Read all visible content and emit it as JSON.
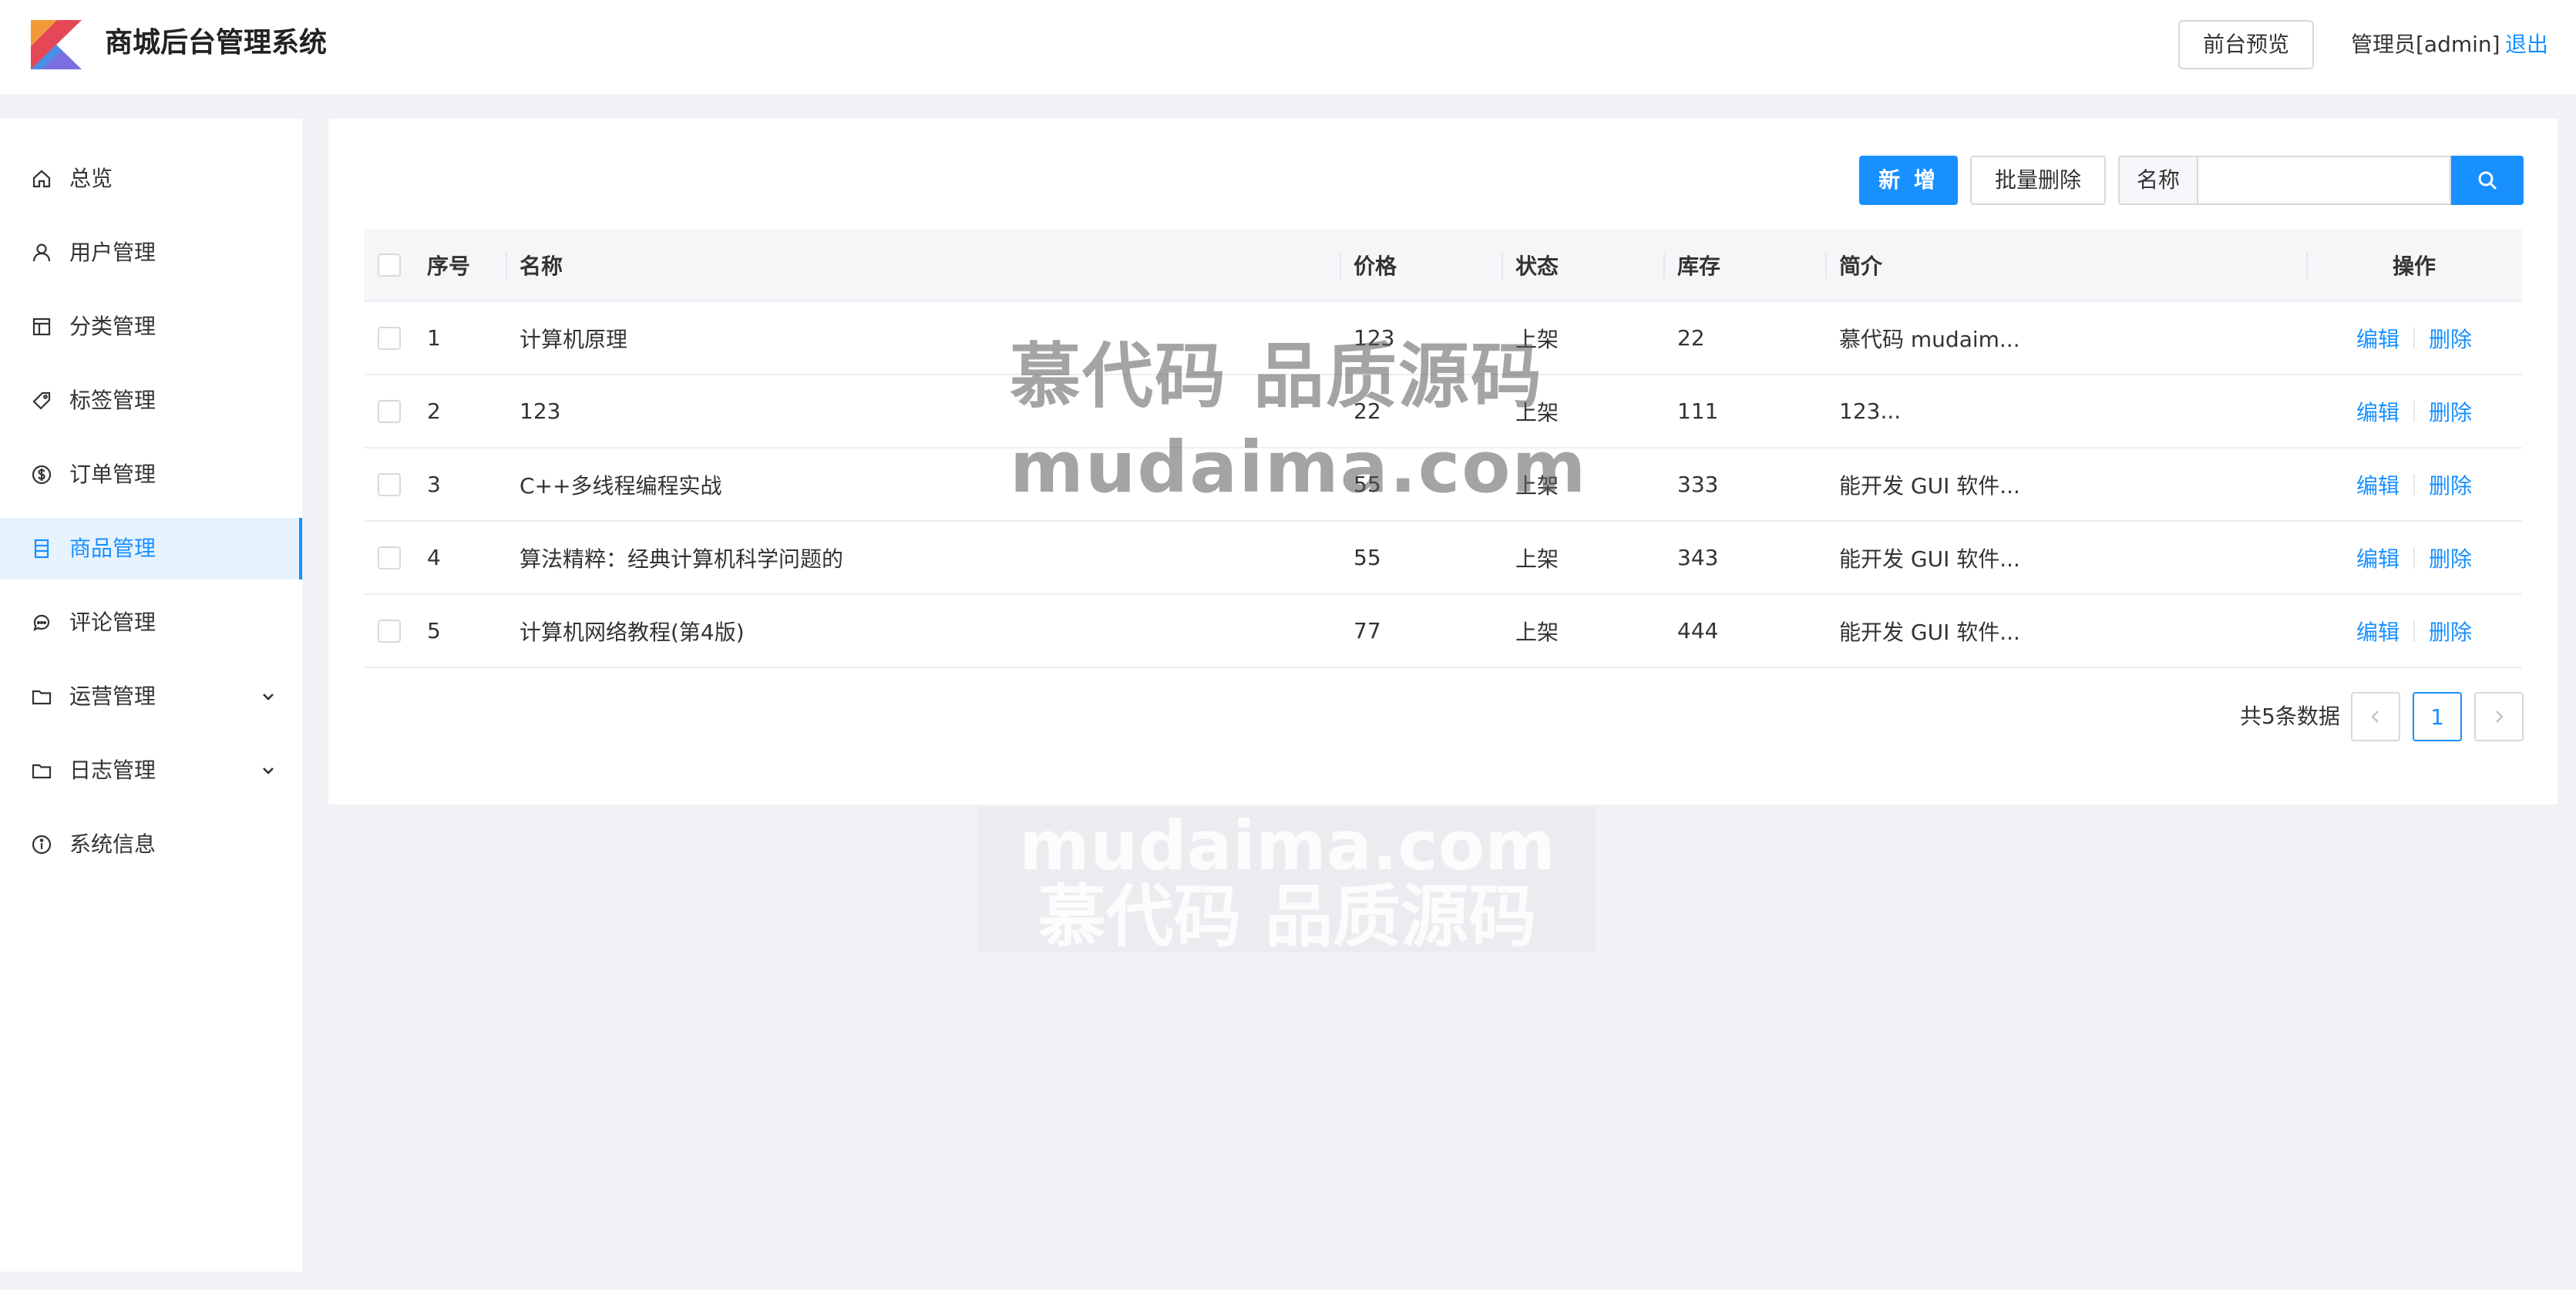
{
  "header": {
    "title": "商城后台管理系统",
    "preview_label": "前台预览",
    "admin_label": "管理员[admin]",
    "logout_label": "退出"
  },
  "sidebar": {
    "items": [
      {
        "label": "总览",
        "icon": "home-icon"
      },
      {
        "label": "用户管理",
        "icon": "user-icon"
      },
      {
        "label": "分类管理",
        "icon": "layout-icon"
      },
      {
        "label": "标签管理",
        "icon": "tag-icon"
      },
      {
        "label": "订单管理",
        "icon": "dollar-icon"
      },
      {
        "label": "商品管理",
        "icon": "list-icon",
        "active": true
      },
      {
        "label": "评论管理",
        "icon": "comment-icon"
      },
      {
        "label": "运营管理",
        "icon": "folder-icon",
        "expandable": true
      },
      {
        "label": "日志管理",
        "icon": "folder-icon",
        "expandable": true
      },
      {
        "label": "系统信息",
        "icon": "info-icon"
      }
    ]
  },
  "toolbar": {
    "add_label": "新 增",
    "batch_delete_label": "批量删除",
    "search_prefix": "名称",
    "search_value": ""
  },
  "table": {
    "columns": [
      "序号",
      "名称",
      "价格",
      "状态",
      "库存",
      "简介",
      "操作"
    ],
    "rows": [
      {
        "index": "1",
        "name": "计算机原理",
        "price": "123",
        "status": "上架",
        "stock": "22",
        "intro": "慕代码 mudaim..."
      },
      {
        "index": "2",
        "name": "123",
        "price": "22",
        "status": "上架",
        "stock": "111",
        "intro": "123..."
      },
      {
        "index": "3",
        "name": "C++多线程编程实战",
        "price": "55",
        "status": "上架",
        "stock": "333",
        "intro": "能开发 GUI 软件..."
      },
      {
        "index": "4",
        "name": "算法精粹：经典计算机科学问题的",
        "price": "55",
        "status": "上架",
        "stock": "343",
        "intro": "能开发 GUI 软件..."
      },
      {
        "index": "5",
        "name": "计算机网络教程(第4版)",
        "price": "77",
        "status": "上架",
        "stock": "444",
        "intro": "能开发 GUI 软件..."
      }
    ],
    "edit_label": "编辑",
    "delete_label": "删除"
  },
  "pagination": {
    "total_text": "共5条数据",
    "current_page": "1"
  },
  "watermark": {
    "line1": "慕代码 品质源码",
    "line2": "mudaima.com"
  },
  "colors": {
    "accent": "#1890ff",
    "background": "#f0f2f5"
  }
}
